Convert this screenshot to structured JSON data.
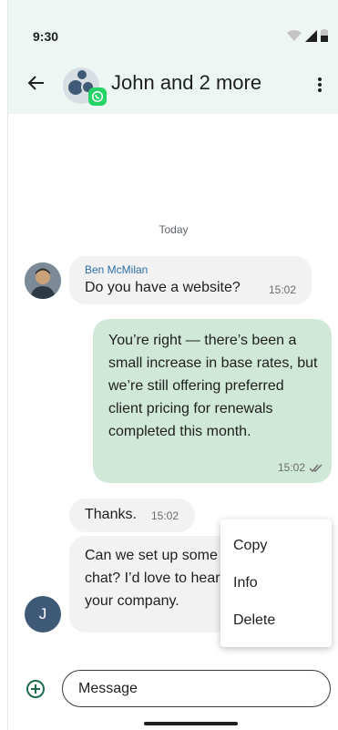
{
  "status_bar": {
    "time": "9:30"
  },
  "header": {
    "title": "John and 2 more"
  },
  "chat": {
    "date_separator": "Today",
    "messages": [
      {
        "sender": "Ben McMilan",
        "text": "Do you have a website?",
        "time": "15:02"
      },
      {
        "text": "You’re right — there’s been a small increase in base rates, but we’re still offering preferred client pricing for renewals completed this month.",
        "time": "15:02"
      },
      {
        "text": "Thanks.",
        "time": "15:02"
      },
      {
        "text": "Can we set up some time to chat? I’d love to hear more about your company."
      }
    ],
    "avatar_initial": "J"
  },
  "context_menu": {
    "items": [
      "Copy",
      "Info",
      "Delete"
    ]
  },
  "compose": {
    "placeholder": "Message"
  },
  "colors": {
    "header_bg": "#eef6f3",
    "outgoing_bubble": "#cfe8d8",
    "incoming_bubble": "#f1f2f1",
    "accent": "#1d6b4a",
    "whatsapp": "#25d366"
  },
  "icons": [
    "back-arrow-icon",
    "group-avatar-icon",
    "whatsapp-icon",
    "more-vert-icon",
    "wifi-icon",
    "signal-icon",
    "battery-icon",
    "double-check-icon",
    "add-circle-icon"
  ]
}
